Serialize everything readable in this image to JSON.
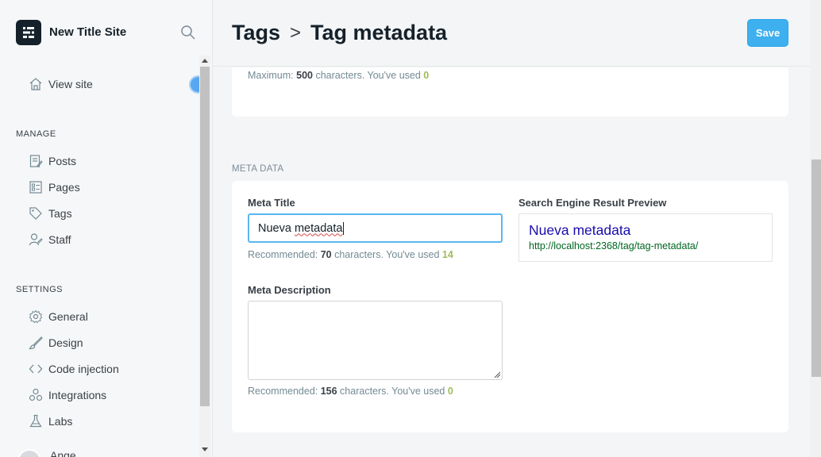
{
  "sidebar": {
    "site_title": "New Title Site",
    "view_site": "View site",
    "manage_heading": "MANAGE",
    "manage_items": [
      "Posts",
      "Pages",
      "Tags",
      "Staff"
    ],
    "settings_heading": "SETTINGS",
    "settings_items": [
      "General",
      "Design",
      "Code injection",
      "Integrations",
      "Labs"
    ],
    "user_name": "Ange"
  },
  "header": {
    "breadcrumb_parent": "Tags",
    "breadcrumb_separator": ">",
    "breadcrumb_current": "Tag metadata",
    "save_label": "Save"
  },
  "description_counter": {
    "prefix": "Maximum: ",
    "limit": "500",
    "middle": " characters. You've used ",
    "used": "0"
  },
  "meta": {
    "section_label": "META DATA",
    "title_label": "Meta Title",
    "title_value_word1": "Nueva",
    "title_value_word2": "metadata",
    "title_counter": {
      "prefix": "Recommended: ",
      "limit": "70",
      "middle": " characters. You've used ",
      "used": "14"
    },
    "description_label": "Meta Description",
    "description_value": "",
    "description_counter": {
      "prefix": "Recommended: ",
      "limit": "156",
      "middle": " characters. You've used ",
      "used": "0"
    },
    "preview_label": "Search Engine Result Preview",
    "preview_title": "Nueva metadata",
    "preview_url": "http://localhost:2368/tag/tag-metadata/"
  },
  "colors": {
    "accent": "#3eb0ef",
    "used_count": "#9fbb58",
    "preview_title": "#1a0dab",
    "preview_url": "#006621"
  },
  "icons": [
    "logo-icon",
    "search-icon",
    "home-icon",
    "posts-icon",
    "pages-icon",
    "tag-icon",
    "staff-icon",
    "gear-icon",
    "brush-icon",
    "code-icon",
    "integrations-icon",
    "flask-icon"
  ]
}
